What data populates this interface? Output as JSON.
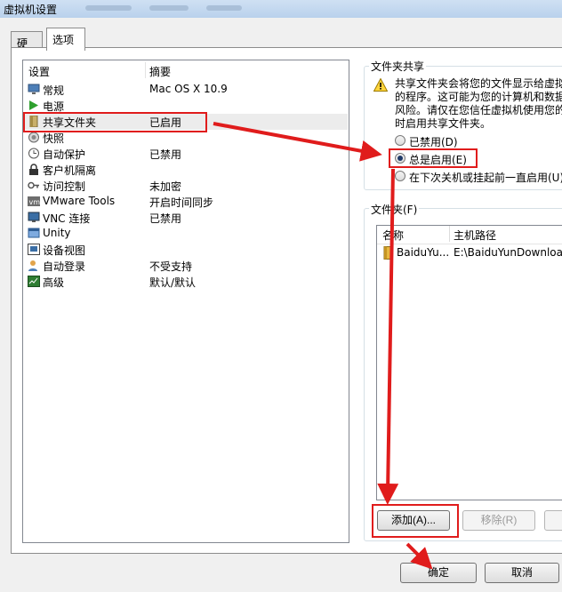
{
  "window": {
    "title": "虚拟机设置"
  },
  "tabs": [
    {
      "label": "硬件",
      "active": false
    },
    {
      "label": "选项",
      "active": true
    }
  ],
  "settings": {
    "col_setting": "设置",
    "col_summary": "摘要",
    "items": [
      {
        "label": "常规",
        "summary": "Mac OS X 10.9",
        "icon": "monitor-icon",
        "selected": false
      },
      {
        "label": "电源",
        "summary": "",
        "icon": "play-icon",
        "selected": false
      },
      {
        "label": "共享文件夹",
        "summary": "已启用",
        "icon": "shared-folder-icon",
        "selected": true
      },
      {
        "label": "快照",
        "summary": "",
        "icon": "snapshot-icon",
        "selected": false
      },
      {
        "label": "自动保护",
        "summary": "已禁用",
        "icon": "clock-icon",
        "selected": false
      },
      {
        "label": "客户机隔离",
        "summary": "",
        "icon": "lock-icon",
        "selected": false
      },
      {
        "label": "访问控制",
        "summary": "未加密",
        "icon": "key-icon",
        "selected": false
      },
      {
        "label": "VMware Tools",
        "summary": "开启时间同步",
        "icon": "vmware-icon",
        "selected": false
      },
      {
        "label": "VNC 连接",
        "summary": "已禁用",
        "icon": "vnc-icon",
        "selected": false
      },
      {
        "label": "Unity",
        "summary": "",
        "icon": "unity-icon",
        "selected": false
      },
      {
        "label": "设备视图",
        "summary": "",
        "icon": "device-view-icon",
        "selected": false
      },
      {
        "label": "自动登录",
        "summary": "不受支持",
        "icon": "user-icon",
        "selected": false
      },
      {
        "label": "高级",
        "summary": "默认/默认",
        "icon": "advanced-icon",
        "selected": false
      }
    ]
  },
  "folder_sharing": {
    "title": "文件夹共享",
    "warning": "共享文件夹会将您的文件显示给虚拟\n的程序。这可能为您的计算机和数据\n风险。请仅在您信任虚拟机使用您的\n时启用共享文件夹。",
    "options": [
      {
        "label": "已禁用(D)",
        "checked": false
      },
      {
        "label": "总是启用(E)",
        "checked": true
      },
      {
        "label": "在下次关机或挂起前一直启用(U)",
        "checked": false
      }
    ]
  },
  "folders": {
    "title": "文件夹(F)",
    "col_name": "名称",
    "col_host_path": "主机路径",
    "rows": [
      {
        "name": "BaiduYu...",
        "host_path": "E:\\BaiduYunDownload"
      }
    ],
    "add_label": "添加(A)...",
    "remove_label": "移除(R)"
  },
  "dialog": {
    "ok_label": "确定",
    "cancel_label": "取消"
  },
  "colors": {
    "highlight_red": "#e01c1c",
    "selection": "#ececec"
  }
}
